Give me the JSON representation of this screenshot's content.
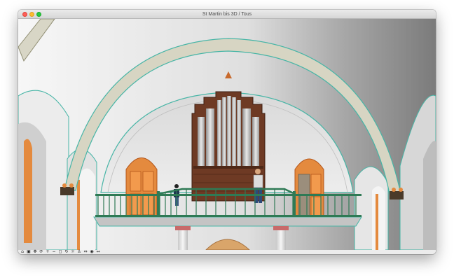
{
  "window": {
    "title": "St Martin bis 3D / Tous"
  },
  "toolbar": {
    "tools": [
      {
        "name": "walk-icon",
        "glyph": "⌂"
      },
      {
        "name": "camera-icon",
        "glyph": "▣"
      },
      {
        "name": "pan-icon",
        "glyph": "✥"
      },
      {
        "name": "orbit-icon",
        "glyph": "⟳"
      },
      {
        "name": "zoom-in-icon",
        "glyph": "+"
      },
      {
        "name": "zoom-out-icon",
        "glyph": "−"
      },
      {
        "name": "fit-icon",
        "glyph": "◻"
      },
      {
        "name": "rotate-icon",
        "glyph": "↻"
      },
      {
        "name": "sun-icon",
        "glyph": "☼"
      },
      {
        "name": "person-icon",
        "glyph": "♙"
      },
      {
        "name": "scale-icon",
        "glyph": "⇔"
      },
      {
        "name": "look-icon",
        "glyph": "◉"
      },
      {
        "name": "measure-icon",
        "glyph": "↔"
      }
    ]
  },
  "colors": {
    "wall": "#e4e4e4",
    "vault_dark": "#5d5d5d",
    "arch_edge": "#47b5a6",
    "organ_wood": "#6e3a24",
    "door_orange": "#e48a3e",
    "railing_green": "#2f7a55"
  }
}
